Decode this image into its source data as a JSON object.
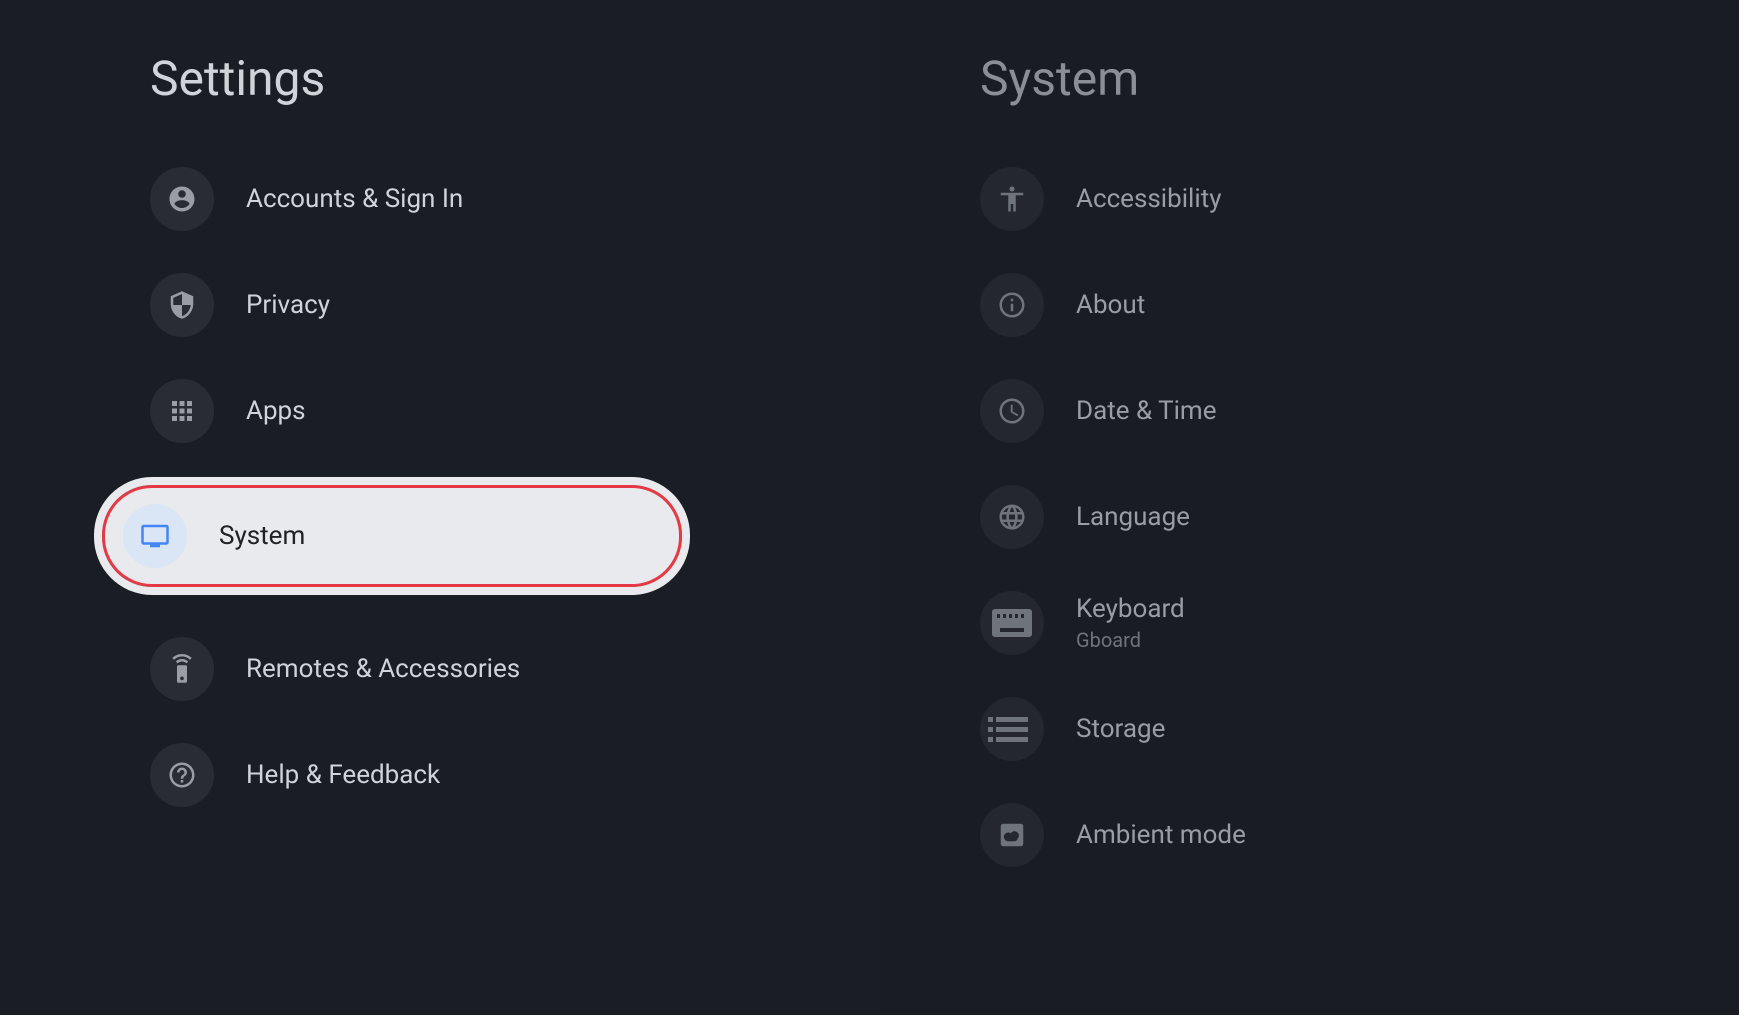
{
  "leftPanel": {
    "title": "Settings",
    "items": [
      {
        "label": "Accounts & Sign In",
        "icon": "account"
      },
      {
        "label": "Privacy",
        "icon": "shield"
      },
      {
        "label": "Apps",
        "icon": "grid"
      },
      {
        "label": "System",
        "icon": "monitor",
        "selected": true
      },
      {
        "label": "Remotes & Accessories",
        "icon": "remote"
      },
      {
        "label": "Help & Feedback",
        "icon": "help"
      }
    ]
  },
  "rightPanel": {
    "title": "System",
    "items": [
      {
        "label": "Accessibility",
        "icon": "accessibility"
      },
      {
        "label": "About",
        "icon": "info"
      },
      {
        "label": "Date & Time",
        "icon": "clock"
      },
      {
        "label": "Language",
        "icon": "globe"
      },
      {
        "label": "Keyboard",
        "sublabel": "Gboard",
        "icon": "keyboard"
      },
      {
        "label": "Storage",
        "icon": "storage"
      },
      {
        "label": "Ambient mode",
        "icon": "cloud"
      }
    ]
  }
}
